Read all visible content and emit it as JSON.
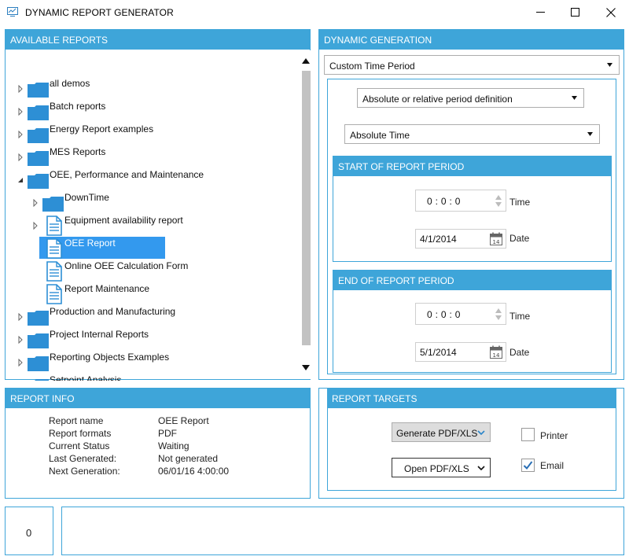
{
  "window": {
    "title": "DYNAMIC REPORT GENERATOR",
    "icon": "monitor-chart-icon",
    "controls": [
      "minimize-icon",
      "maximize-icon",
      "close-icon"
    ]
  },
  "available_reports": {
    "header": "AVAILABLE REPORTS",
    "items": [
      {
        "label": "all demos",
        "type": "folder",
        "expanded": false
      },
      {
        "label": "Batch reports",
        "type": "folder",
        "expanded": false
      },
      {
        "label": "Energy Report examples",
        "type": "folder",
        "expanded": false
      },
      {
        "label": "MES Reports",
        "type": "folder",
        "expanded": false
      },
      {
        "label": "OEE, Performance and Maintenance",
        "type": "folder",
        "expanded": true
      },
      {
        "label": "DownTime",
        "type": "folder",
        "expanded": false
      },
      {
        "label": "Equipment availability report",
        "type": "document",
        "expanded": false
      },
      {
        "label": "OEE Report",
        "type": "document",
        "selected": true
      },
      {
        "label": "Online OEE Calculation Form",
        "type": "document"
      },
      {
        "label": "Report Maintenance",
        "type": "document"
      },
      {
        "label": "Production and Manufacturing",
        "type": "folder",
        "expanded": false
      },
      {
        "label": "Project Internal Reports",
        "type": "folder",
        "expanded": false
      },
      {
        "label": "Reporting Objects Examples",
        "type": "folder",
        "expanded": false
      },
      {
        "label": "Setpoint Analysis",
        "type": "folder",
        "expanded": false
      }
    ]
  },
  "report_info": {
    "header": "REPORT INFO",
    "rows": [
      {
        "label": "Report name",
        "value": "OEE Report"
      },
      {
        "label": "Report formats",
        "value": "PDF"
      },
      {
        "label": "Current Status",
        "value": "Waiting"
      },
      {
        "label": "Last Generated:",
        "value": "Not generated"
      },
      {
        "label": "Next Generation:",
        "value": "06/01/16 4:00:00"
      }
    ]
  },
  "dynamic_generation": {
    "header": "DYNAMIC GENERATION",
    "period_mode": "Custom Time Period",
    "definition_mode": "Absolute or relative period definition",
    "time_type": "Absolute Time",
    "start": {
      "header": "START OF REPORT PERIOD",
      "time": "0 : 0 : 0",
      "time_label": "Time",
      "date": "4/1/2014",
      "date_label": "Date",
      "calendar_day": "14"
    },
    "end": {
      "header": "END OF REPORT PERIOD",
      "time": "0 : 0 : 0",
      "time_label": "Time",
      "date": "5/1/2014",
      "date_label": "Date",
      "calendar_day": "14"
    }
  },
  "report_targets": {
    "header": "REPORT TARGETS",
    "generate_label": "Generate PDF/XLS",
    "open_label": "Open PDF/XLS",
    "printer_label": "Printer",
    "printer_checked": false,
    "email_label": "Email",
    "email_checked": true
  },
  "status_bar": {
    "count": "0",
    "message": ""
  },
  "colors": {
    "accent": "#3ea5d9",
    "selection": "#3399ee",
    "folder": "#2d8fd5"
  }
}
